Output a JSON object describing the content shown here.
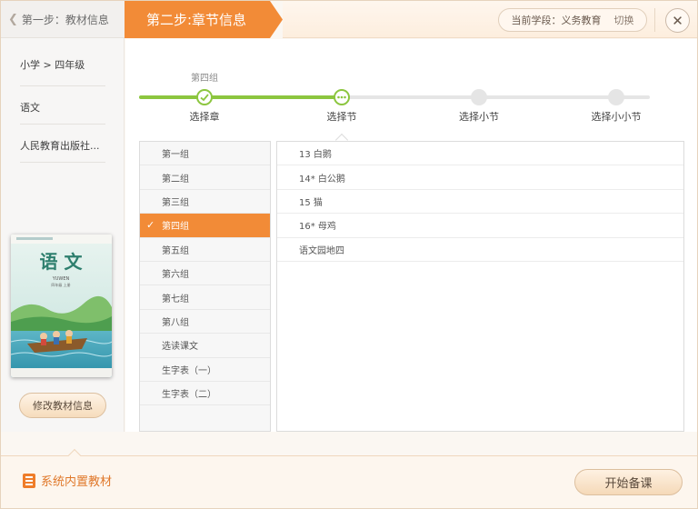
{
  "header": {
    "step1_label": "第一步：教材信息",
    "step2_label": "第二步:章节信息",
    "stage_label": "当前学段：义务教育",
    "stage_switch": "切换"
  },
  "sidebar": {
    "crumbs": [
      "小学 > 四年级",
      "语文",
      "人民教育出版社..."
    ],
    "book_cover": {
      "title": "语 文",
      "pinyin": "YUWEN",
      "grade": "四年级 上册"
    },
    "edit_button": "修改教材信息"
  },
  "progress": {
    "current_chapter": "第四组",
    "steps": [
      {
        "label": "选择章",
        "state": "done"
      },
      {
        "label": "选择节",
        "state": "current"
      },
      {
        "label": "选择小节",
        "state": "pending"
      },
      {
        "label": "选择小小节",
        "state": "pending"
      }
    ]
  },
  "groups": [
    {
      "label": "第一组",
      "active": false
    },
    {
      "label": "第二组",
      "active": false
    },
    {
      "label": "第三组",
      "active": false
    },
    {
      "label": "第四组",
      "active": true
    },
    {
      "label": "第五组",
      "active": false
    },
    {
      "label": "第六组",
      "active": false
    },
    {
      "label": "第七组",
      "active": false
    },
    {
      "label": "第八组",
      "active": false
    },
    {
      "label": "选读课文",
      "active": false
    },
    {
      "label": "生字表（一）",
      "active": false
    },
    {
      "label": "生字表（二）",
      "active": false
    }
  ],
  "lessons": [
    "13 白鹅",
    "14* 白公鹅",
    "15 猫",
    "16* 母鸡",
    "语文园地四"
  ],
  "footer": {
    "builtin_label": "系统内置教材",
    "start_button": "开始备课"
  },
  "colors": {
    "accent": "#f28b37",
    "progress_done": "#8cc63f",
    "progress_pending": "#e5e5e5"
  }
}
